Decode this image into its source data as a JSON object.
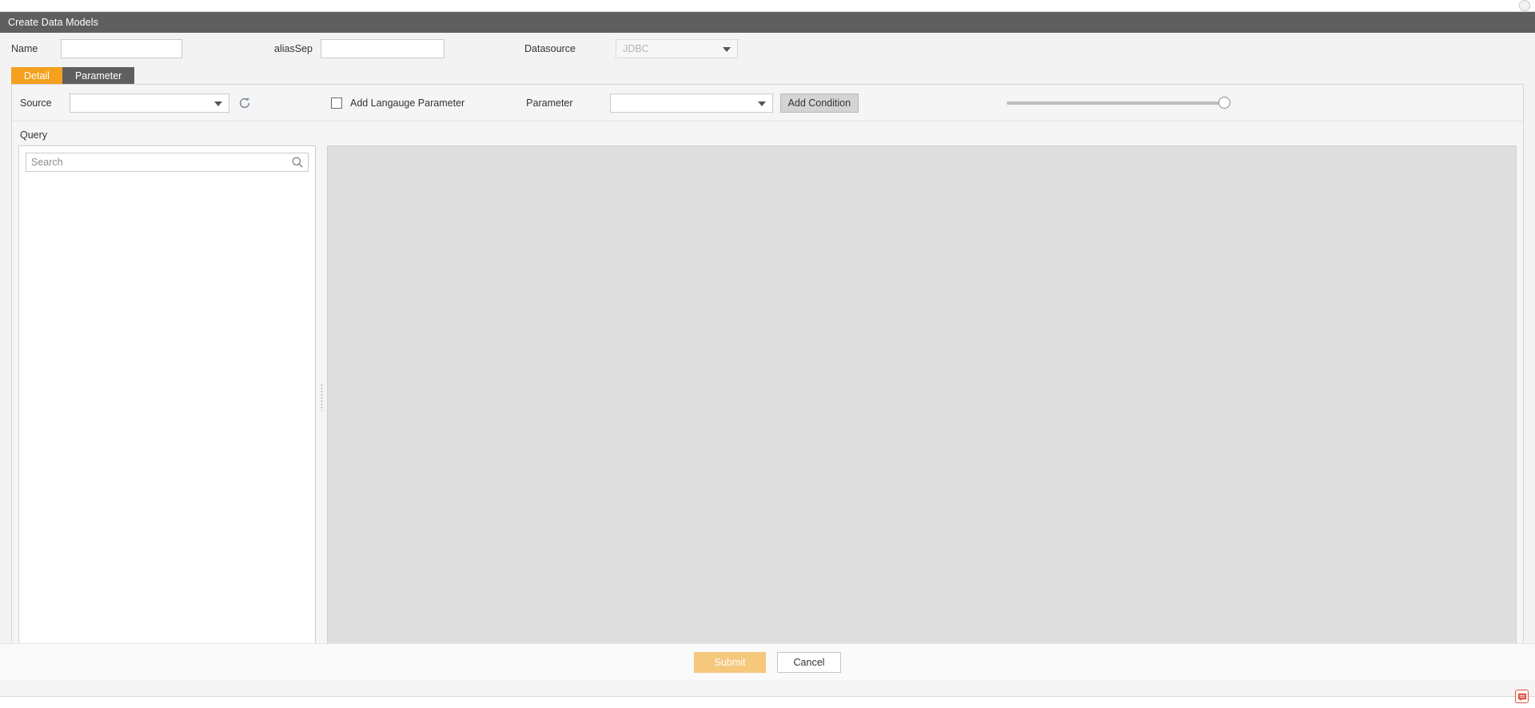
{
  "window": {
    "title": "Create Data Models"
  },
  "header": {
    "name_label": "Name",
    "name_value": "",
    "name_placeholder": "",
    "aliassep_label": "aliasSep",
    "aliassep_value": "",
    "aliassep_placeholder": "",
    "datasource_label": "Datasource",
    "datasource_value": "JDBC"
  },
  "tabs": [
    {
      "label": "Detail",
      "active": true
    },
    {
      "label": "Parameter",
      "active": false
    }
  ],
  "detail": {
    "source_label": "Source",
    "source_value": "",
    "refresh_icon": "refresh-icon",
    "add_language_parameter_label": "Add Langauge Parameter",
    "add_language_parameter_checked": false,
    "parameter_label": "Parameter",
    "parameter_value": "",
    "add_condition_label": "Add Condition",
    "slider_value": 100
  },
  "query": {
    "label": "Query",
    "search_placeholder": "Search",
    "search_value": "",
    "search_icon": "search-icon",
    "tree_items": [],
    "editor_content": ""
  },
  "footer": {
    "submit_label": "Submit",
    "cancel_label": "Cancel"
  },
  "colors": {
    "titlebar": "#5f5f5f",
    "tab_active": "#f5a01e",
    "tab_inactive": "#5f5f5f",
    "submit": "#f5c87c",
    "editor_bg": "#dedede"
  }
}
